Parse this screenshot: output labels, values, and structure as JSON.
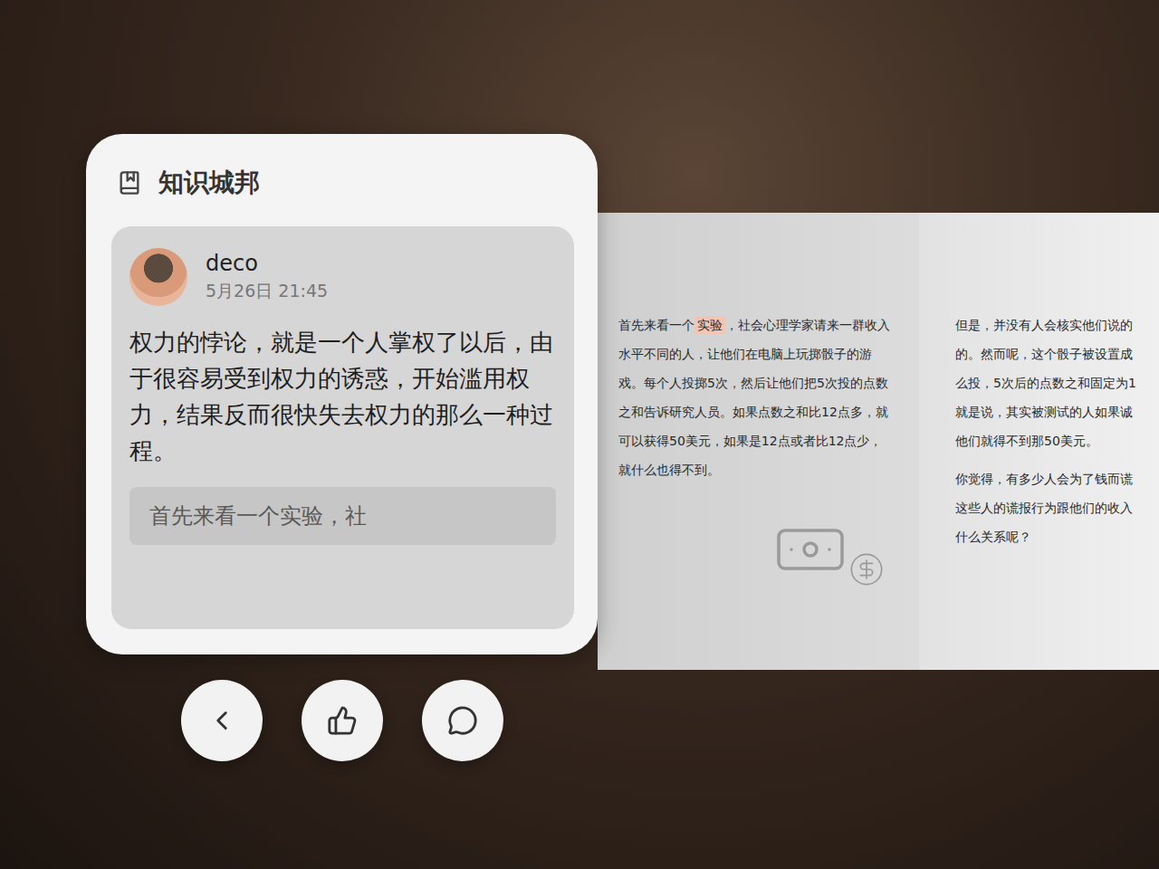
{
  "app": {
    "title": "知识城邦"
  },
  "post": {
    "author": "deco",
    "time": "5月26日 21:45",
    "text": "权力的悖论，就是一个人掌权了以后，由于很容易受到权力的诱惑，开始滥用权力，结果反而很快失去权力的那么一种过程。",
    "quote": "首先来看一个实验，社"
  },
  "booklet": {
    "page_left": {
      "before": "首先来看一个",
      "highlight": "实验",
      "after": "，社会心理学家请来一群收入水平不同的人，让他们在电脑上玩掷骰子的游戏。每个人投掷5次，然后让他们把5次投的点数之和告诉研究人员。如果点数之和比12点多，就可以获得50美元，如果是12点或者比12点少，就什么也得不到。"
    },
    "page_right": {
      "paragraphs": [
        [
          "但是，并没有人会核实他们说的",
          "的。然而呢，这个骰子被设置成",
          "么投，5次后的点数之和固定为1",
          "就是说，其实被测试的人如果诚",
          "他们就得不到那50美元。"
        ],
        [
          "你觉得，有多少人会为了钱而谎",
          "这些人的谎报行为跟他们的收入",
          "什么关系呢？"
        ]
      ]
    }
  }
}
